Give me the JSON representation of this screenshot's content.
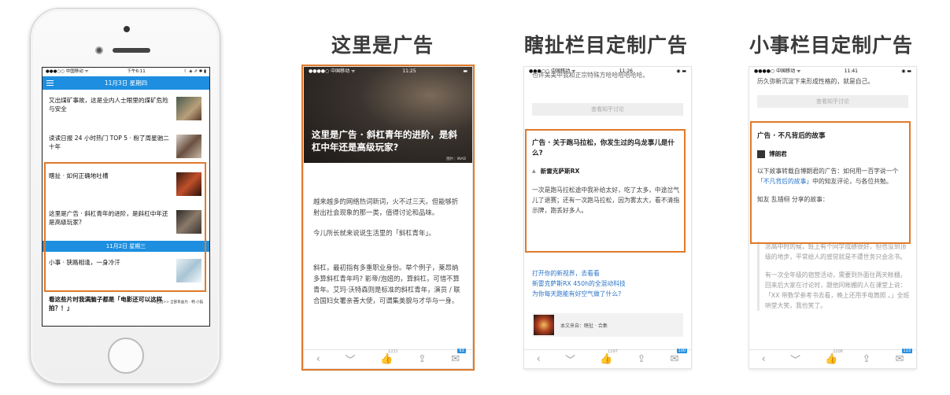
{
  "columns": {
    "ad_here": "这里是广告",
    "qiche_custom": "瞎扯栏目定制广告",
    "xiaoshi_custom": "小事栏目定制广告"
  },
  "phone": {
    "status": {
      "carrier": "●●●○○ 中国移动 ᯤ",
      "time": "下午6:11",
      "icons": "☾ ◈ ⇗ ✱ ▮"
    },
    "header_date": "11月3日 星期四",
    "items": [
      {
        "title": "又出煤矿事故，这是业内人士眼里的煤矿危险与安全"
      },
      {
        "title": "读读日报 24 小时热门 TOP 5 · 粉了周星驰二十年"
      },
      {
        "title": "瞎扯 · 如何正确地吐槽"
      },
      {
        "title": "这里是广告 · 斜杠青年的进阶，是斜杠中年还是高级玩家?"
      }
    ],
    "date_bar": "11月2日 星期三",
    "item_after": "小事 · 狭路相逢，一身冷汗",
    "last_title": "看这些片时我满脑子都是「电影还可以这样拍？！」",
    "last_mini": "<<出租>> 全部系画为 · 韩·小猫"
  },
  "screen2": {
    "status": {
      "carrier": "●●●●○ 中国移动 ᯤ",
      "time": "11:25",
      "battery": "▬"
    },
    "hero_title": "这里是广告 · 斜杠青年的进阶，是斜杠中年还是高级玩家?",
    "hero_credit": "图片：INAD",
    "paragraphs": [
      "越来越多的网络热词新词，火不过三天。但能够折射出社会现象的那一类，值得讨论和品味。",
      "今儿所长就来说说生活里的「斜杠青年」。",
      "斜杠，最初指有多重职业身份。举个例子，莱昂纳多算斜杠青年吗? 影帝/泡妞的，算斜杠，可惜不算青年。艾玛·沃特森则是标准的斜杠青年，演员 / 联合国妇女署亲善大使，可谓集美貌与才华与一身。"
    ],
    "toolbar": {
      "back": "‹",
      "down": "﹀",
      "like": "👍",
      "like_count": "1221",
      "share": "⇪",
      "comment": "✉",
      "comment_count": "93"
    }
  },
  "screen3": {
    "status": {
      "carrier": "●●●○○ 中国移动 ᯤ",
      "time": "11:26",
      "battery": "◉ ▬"
    },
    "top_text": "也许美美中我和正宗特殊方哈哈哈哈哈哈。",
    "discuss_btn": "查看知乎讨论",
    "ad_title": "广告 · 关于跑马拉松，你发生过的乌龙事儿是什么?",
    "ad_author": "新雷克萨斯RX",
    "ad_body": "一次是跑马拉松途中我补给太好，吃了太多，中途岔气儿了退赛；还有一次跑马拉松，因为雾太大，看不清指示牌，跑丢好多人。",
    "links": [
      "打开你的新视界，去看看",
      "新雷克萨斯RX 450h的全混动科技",
      "为你每天跑能有好空气做了什么?"
    ],
    "source": "本文来自：瞎扯 · 合集",
    "toolbar": {
      "back": "‹",
      "down": "﹀",
      "like": "👍",
      "like_count": "1297",
      "share": "⇪",
      "comment": "✉",
      "comment_count": "100"
    }
  },
  "screen4": {
    "status": {
      "carrier": "●●●●○ 中国移动 ᯤ",
      "time": "11:41",
      "battery": "◉ ▬"
    },
    "top_text": "历久弥新沉淀下来形成性格的，就是自己。",
    "discuss_btn": "查看知乎讨论",
    "ad_title": "广告 · 不凡背后的故事",
    "ad_author": "博朗君",
    "ad_body_1": "以下故事转载自博朗君的广告：如何用一百字说一个",
    "ad_body_link": "「不凡背后的故事」",
    "ad_body_2": "中的知友评论，与各位共勉。",
    "ad_share": "知友 乱错栩 分享的故事：",
    "fade_1": "念高中时的候，班上有个同学成绩很好，但也没到顶级的地步，平常给人的感觉就是不遭世务只会念书。",
    "fade_2": "有一次全年级的宿营活动，需要到外面住两天帐棚。回来后大家在讨论时，跟他同帐棚的人在课堂上说：「XX 带数学参考书去看，晚上还用手电筒照 。」全班哄堂大笑，我也笑了。",
    "toolbar": {
      "back": "‹",
      "down": "﹀",
      "like": "👍",
      "like_count": "2206",
      "share": "⇪",
      "comment": "✉",
      "comment_count": "113"
    }
  }
}
